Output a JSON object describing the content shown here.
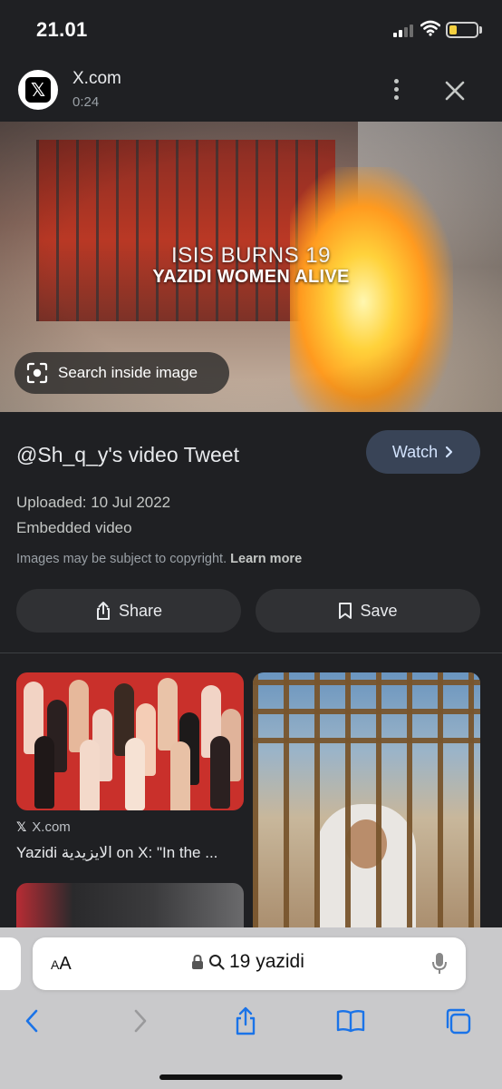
{
  "status_bar": {
    "time": "21.01"
  },
  "source": {
    "logo_text": "𝕏",
    "name": "X.com",
    "duration": "0:24"
  },
  "hero": {
    "overlay_line1": "ISIS BURNS 19",
    "overlay_line2": "YAZIDI WOMEN ALIVE",
    "search_inside_label": "Search inside image"
  },
  "info": {
    "title": "@Sh_q_y's video Tweet",
    "watch_label": "Watch",
    "uploaded": "Uploaded: 10 Jul 2022",
    "embedded": "Embedded video",
    "copyright_text": "Images may be subject to copyright.",
    "learn_more": "Learn more",
    "share_label": "Share",
    "save_label": "Save"
  },
  "results": [
    {
      "source_icon": "x-logo-icon",
      "source": "X.com",
      "title": "Yazidi الايزيدية on X: \"In the ..."
    }
  ],
  "browser": {
    "aa_label": "A",
    "aa_label_small": "A",
    "url_text": "19 yazidi"
  },
  "colors": {
    "background": "#1f2023",
    "watch_button": "#394457",
    "action_button": "#303134",
    "browser_bar": "#c9c9cb",
    "ios_blue": "#1a73e8"
  },
  "icons": [
    "signal-icon",
    "wifi-icon",
    "battery-icon",
    "more-vert-icon",
    "close-icon",
    "lens-camera-icon",
    "chevron-right-icon",
    "share-icon",
    "bookmark-icon",
    "lock-icon",
    "search-icon",
    "mic-icon",
    "back-icon",
    "forward-icon",
    "share-sheet-icon",
    "bookmarks-icon",
    "tabs-icon"
  ]
}
